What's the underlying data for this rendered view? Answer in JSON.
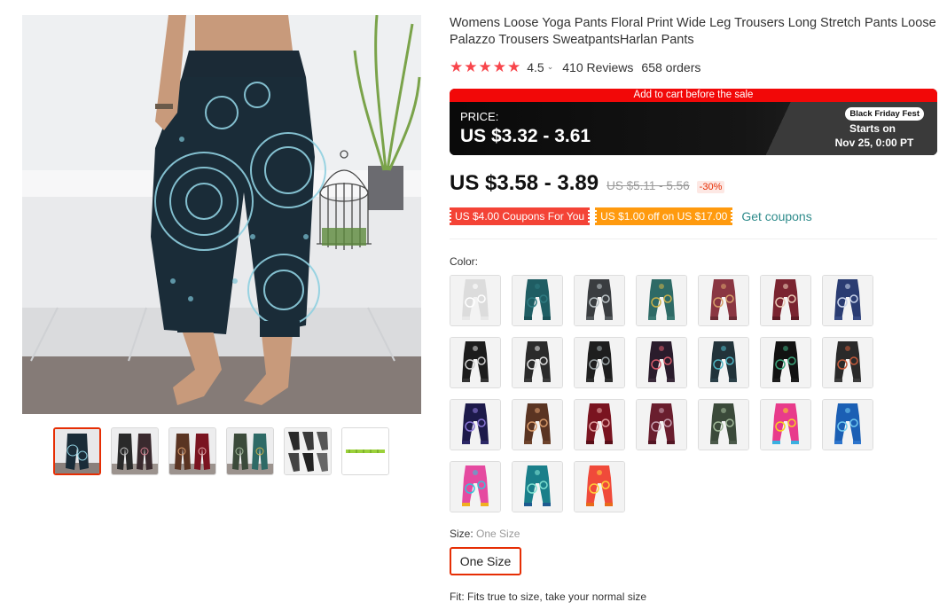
{
  "product": {
    "title": "Womens Loose Yoga Pants Floral Print Wide Leg Trousers Long Stretch Pants Loose Palazzo Trousers SweatpantsHarlan Pants",
    "rating": "4.5",
    "reviews": "410 Reviews",
    "orders": "658 orders"
  },
  "sale_banner": {
    "top_text": "Add to cart before the sale",
    "price_label": "PRICE:",
    "price_range": "US $3.32 - 3.61",
    "event_badge": "Black Friday Fest",
    "starts_label": "Starts on",
    "start_date": "Nov 25, 0:00 PT"
  },
  "pricing": {
    "current": "US $3.58 - 3.89",
    "original": "US $5.11 - 5.56",
    "discount": "-30%"
  },
  "coupons": {
    "coupon_1": "US $4.00 Coupons For You",
    "coupon_2": "US $1.00 off on US $17.00",
    "get_link": "Get coupons"
  },
  "color": {
    "label": "Color:",
    "swatches": [
      {
        "top": "#dcdcdc",
        "pattern": "#ffffff",
        "leg": "#e8e8e8"
      },
      {
        "top": "#1f5d63",
        "pattern": "#2e7a80",
        "leg": "#1b5258"
      },
      {
        "top": "#3a3d40",
        "pattern": "#b9c1c4",
        "leg": "#555a5d"
      },
      {
        "top": "#2e6a66",
        "pattern": "#c9b04a",
        "leg": "#3c7a74"
      },
      {
        "top": "#8a3642",
        "pattern": "#d7a06a",
        "leg": "#6b2a34"
      },
      {
        "top": "#7a2430",
        "pattern": "#e9c9b5",
        "leg": "#5e1a24"
      },
      {
        "top": "#2a3c72",
        "pattern": "#c8d3ea",
        "leg": "#394c85"
      },
      {
        "top": "#1c1c1c",
        "pattern": "#d0d0d0",
        "leg": "#333333"
      },
      {
        "top": "#2b2b2b",
        "pattern": "#e0e0e0",
        "leg": "#3a3a3a"
      },
      {
        "top": "#1e1e1e",
        "pattern": "#9aa3a5",
        "leg": "#2e2e2e"
      },
      {
        "top": "#2a1c2c",
        "pattern": "#d55a6a",
        "leg": "#3a2a3a"
      },
      {
        "top": "#22333a",
        "pattern": "#4db3c2",
        "leg": "#2b4048"
      },
      {
        "top": "#121212",
        "pattern": "#3aa37a",
        "leg": "#1c1c1c"
      },
      {
        "top": "#2a2a2a",
        "pattern": "#c45a3a",
        "leg": "#3b3b3b"
      },
      {
        "top": "#1d1a4a",
        "pattern": "#8a77d6",
        "leg": "#2b2766"
      },
      {
        "top": "#5a3422",
        "pattern": "#d79a6a",
        "leg": "#6e432c"
      },
      {
        "top": "#7a1420",
        "pattern": "#e0a0a0",
        "leg": "#5a0e18"
      },
      {
        "top": "#6a1e2e",
        "pattern": "#c8a0b0",
        "leg": "#541624"
      },
      {
        "top": "#3b4a3a",
        "pattern": "#a0b898",
        "leg": "#4b5a4a"
      },
      {
        "top": "#e83b8b",
        "pattern": "#f7d320",
        "leg": "#3ab0e0"
      },
      {
        "top": "#1b5fb4",
        "pattern": "#6fc7ef",
        "leg": "#2c74cc"
      },
      {
        "top": "#e54aa0",
        "pattern": "#36c2d8",
        "leg": "#f0b020"
      },
      {
        "top": "#1a7f8a",
        "pattern": "#7fe0d0",
        "leg": "#1e5a90"
      },
      {
        "top": "#f04a3a",
        "pattern": "#ffcf3a",
        "leg": "#e86a1a"
      }
    ]
  },
  "size": {
    "label": "Size: ",
    "selected": "One Size",
    "option": "One Size"
  },
  "fit_text": "Fit: Fits true to size, take your normal size",
  "colors": {
    "accent": "#e62e04",
    "star": "#f8454b",
    "link": "#2e8b8b"
  }
}
